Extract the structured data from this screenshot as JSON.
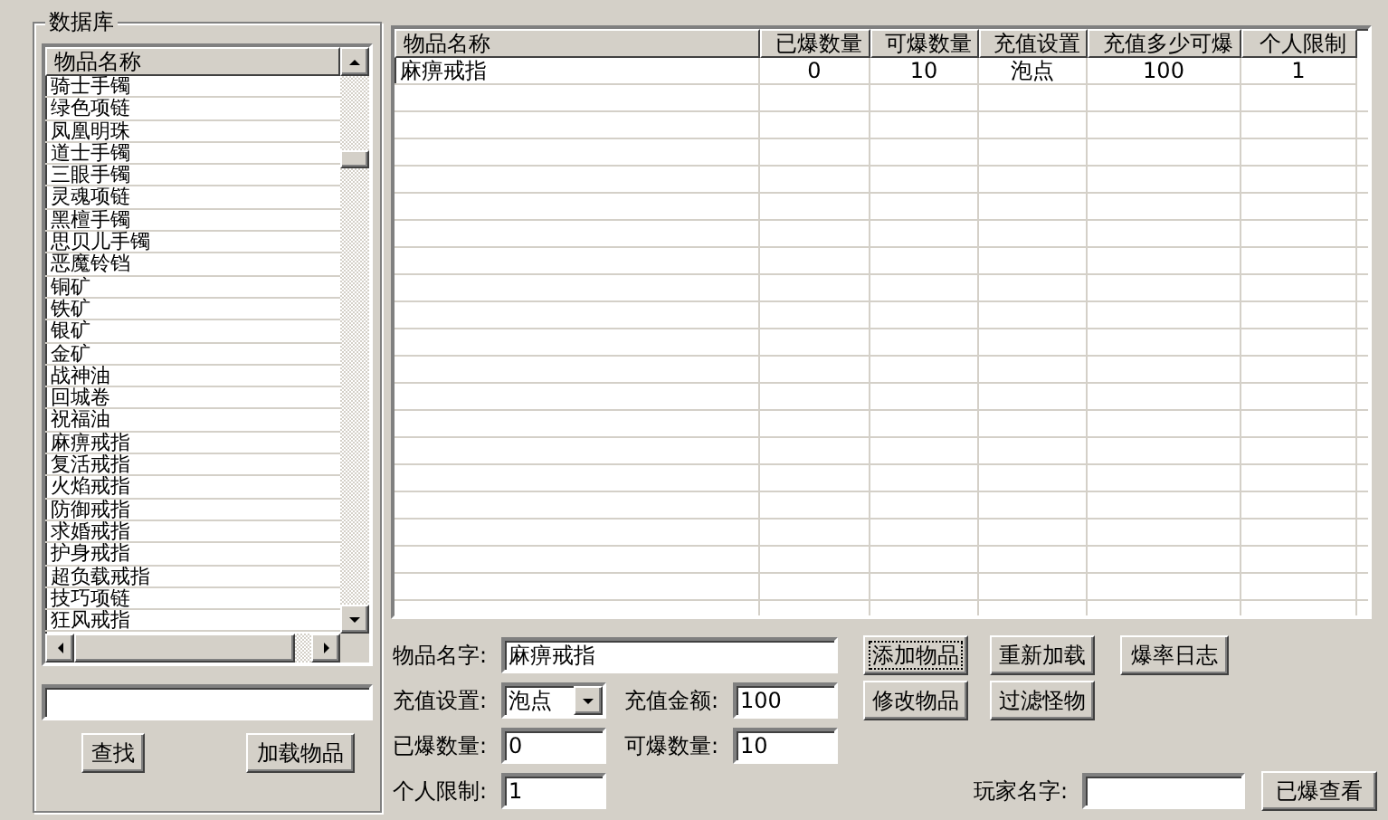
{
  "database": {
    "title": "数据库",
    "list_header": "物品名称",
    "items": [
      "骑士手镯",
      "绿色项链",
      "凤凰明珠",
      "道士手镯",
      "三眼手镯",
      "灵魂项链",
      "黑檀手镯",
      "思贝儿手镯",
      "恶魔铃铛",
      "铜矿",
      "铁矿",
      "银矿",
      "金矿",
      "战神油",
      "回城卷",
      "祝福油",
      "麻痹戒指",
      "复活戒指",
      "火焰戒指",
      "防御戒指",
      "求婚戒指",
      "护身戒指",
      "超负载戒指",
      "技巧项链",
      "狂风戒指"
    ],
    "buttons": [
      "查找",
      "加载物品"
    ]
  },
  "table": {
    "columns": [
      "物品名称",
      "已爆数量",
      "可爆数量",
      "充值设置",
      "充值多少可爆",
      "个人限制"
    ],
    "rows": [
      {
        "cells": [
          "麻痹戒指",
          "0",
          "10",
          "泡点",
          "100",
          "1"
        ]
      }
    ]
  },
  "form": {
    "item_name": {
      "label": "物品名字:",
      "value": "麻痹戒指"
    },
    "recharge_setting": {
      "label": "充值设置:",
      "value": "泡点"
    },
    "recharge_amount": {
      "label": "充值金额:",
      "value": "100"
    },
    "dropped": {
      "label": "已爆数量:",
      "value": "0"
    },
    "droppable": {
      "label": "可爆数量:",
      "value": "10"
    },
    "personal_limit": {
      "label": "个人限制:",
      "value": "1"
    },
    "player_name": {
      "label": "玩家名字:"
    },
    "buttons": [
      {
        "label": "添加物品",
        "focused": true
      },
      {
        "label": "重新加载",
        "focused": false
      },
      {
        "label": "爆率日志",
        "focused": false
      },
      {
        "label": "修改物品",
        "focused": false
      },
      {
        "label": "过滤怪物",
        "focused": false
      },
      {
        "label": "已爆查看",
        "focused": false
      }
    ]
  }
}
